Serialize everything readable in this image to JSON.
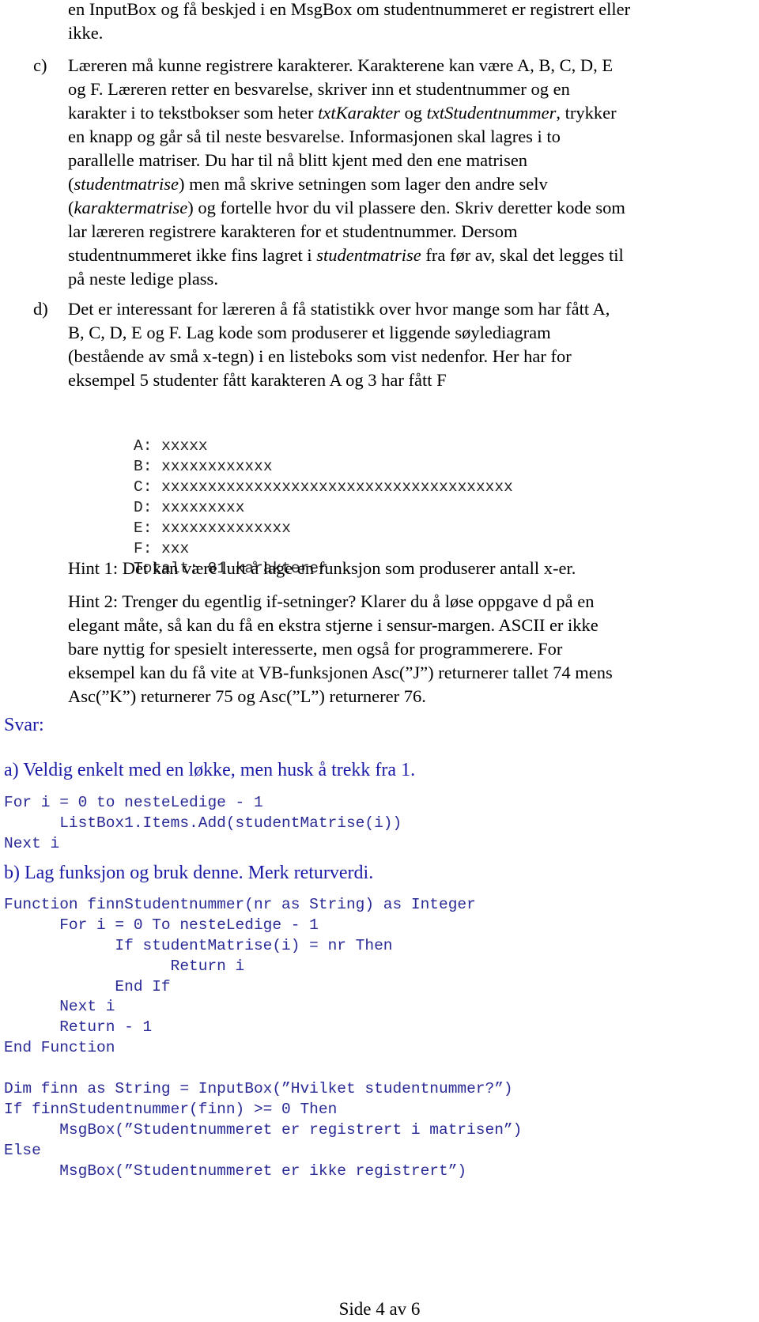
{
  "intro": {
    "line1": "en InputBox og få beskjed i en MsgBox om studentnummeret er registrert eller",
    "line2": "ikke."
  },
  "task_c": {
    "label": "c)",
    "lines": [
      [
        "Læreren må kunne registrere karakterer. Karakterene kan være A, B, C, D, E"
      ],
      [
        "og F. Læreren retter en besvarelse, skriver inn et studentnummer og en"
      ],
      [
        "karakter i to tekstbokser som heter ",
        {
          "i": "txtKarakter"
        },
        " og ",
        {
          "i": "txtStudentnummer"
        },
        ", trykker"
      ],
      [
        "en knapp og går så til neste besvarelse. Informasjonen skal lagres i to"
      ],
      [
        "parallelle matriser. Du har til nå blitt kjent med den ene matrisen"
      ],
      [
        "(",
        {
          "i": "studentmatrise"
        },
        ") men må skrive setningen som lager den andre selv"
      ],
      [
        "(",
        {
          "i": "karaktermatrise"
        },
        ") og fortelle hvor du vil plassere den. Skriv deretter kode som"
      ],
      [
        "lar læreren registrere karakteren for et studentnummer. Dersom"
      ],
      [
        "studentnummeret ikke fins lagret i ",
        {
          "i": "studentmatrise"
        },
        " fra før av, skal det legges til"
      ],
      [
        "på neste ledige plass."
      ]
    ]
  },
  "task_d": {
    "label": "d)",
    "lines": [
      "Det er interessant for læreren å få statistikk over hvor mange som har fått A,",
      "B, C, D, E og F. Lag kode som produserer et liggende søylediagram",
      "(bestående av små x-tegn) i en listeboks som vist nedenfor. Her har for",
      "eksempel 5 studenter fått karakteren A og 3 har fått F"
    ]
  },
  "chart_data": {
    "type": "bar",
    "orientation": "horizontal",
    "mark_char": "x",
    "categories": [
      "A",
      "B",
      "C",
      "D",
      "E",
      "F"
    ],
    "values": [
      5,
      12,
      38,
      9,
      14,
      3
    ],
    "total_label": "Totalt: 81 karakterer",
    "title": "",
    "xlabel": "",
    "ylabel": ""
  },
  "hints": {
    "hint1": "Hint 1: Det kan være lurt å lage en funksjon som produserer antall x-er.",
    "hint2_lines": [
      "Hint 2: Trenger du egentlig if-setninger? Klarer du å løse oppgave d på en",
      "elegant måte, så kan du få en ekstra stjerne i sensur-margen. ASCII er ikke",
      "bare nyttig for spesielt interesserte, men også for programmerere. For",
      "eksempel kan du få vite at VB-funksjonen Asc(”J”) returnerer tallet 74 mens",
      "Asc(”K”) returnerer 75 og Asc(”L”) returnerer 76."
    ]
  },
  "answer": {
    "svar_label": "Svar:",
    "a_heading": "a) Veldig enkelt med en løkke, men husk å trekk fra 1.",
    "a_code": [
      "For i = 0 to nesteLedige - 1",
      "      ListBox1.Items.Add(studentMatrise(i))",
      "Next i"
    ],
    "b_heading": "b) Lag funksjon og bruk denne. Merk returverdi.",
    "b_code": [
      "Function finnStudentnummer(nr as String) as Integer",
      "      For i = 0 To nesteLedige - 1",
      "            If studentMatrise(i) = nr Then",
      "                  Return i",
      "            End If",
      "      Next i",
      "      Return - 1",
      "End Function",
      "",
      "Dim finn as String = InputBox(”Hvilket studentnummer?”)",
      "If finnStudentnummer(finn) >= 0 Then",
      "      MsgBox(”Studentnummeret er registrert i matrisen”)",
      "Else",
      "      MsgBox(”Studentnummeret er ikke registrert”)"
    ]
  },
  "footer": {
    "page": "Side 4 av 6"
  }
}
